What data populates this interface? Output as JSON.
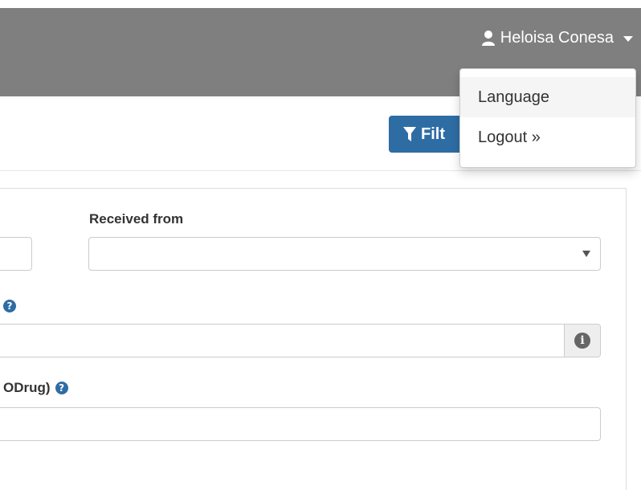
{
  "header": {
    "user_name": "Heloisa Conesa",
    "user_menu": {
      "items": [
        {
          "label": "Language"
        },
        {
          "label": "Logout »"
        }
      ]
    }
  },
  "toolbar": {
    "filter_label": "Filt"
  },
  "form": {
    "received_from_label": "Received from",
    "received_from_value": "",
    "field2_label_tail": "",
    "field2_value": "",
    "field3_label_tail": "ODrug)",
    "field3_value": ""
  },
  "colors": {
    "navbar": "#7f7f7f",
    "primary": "#2e6da4"
  }
}
